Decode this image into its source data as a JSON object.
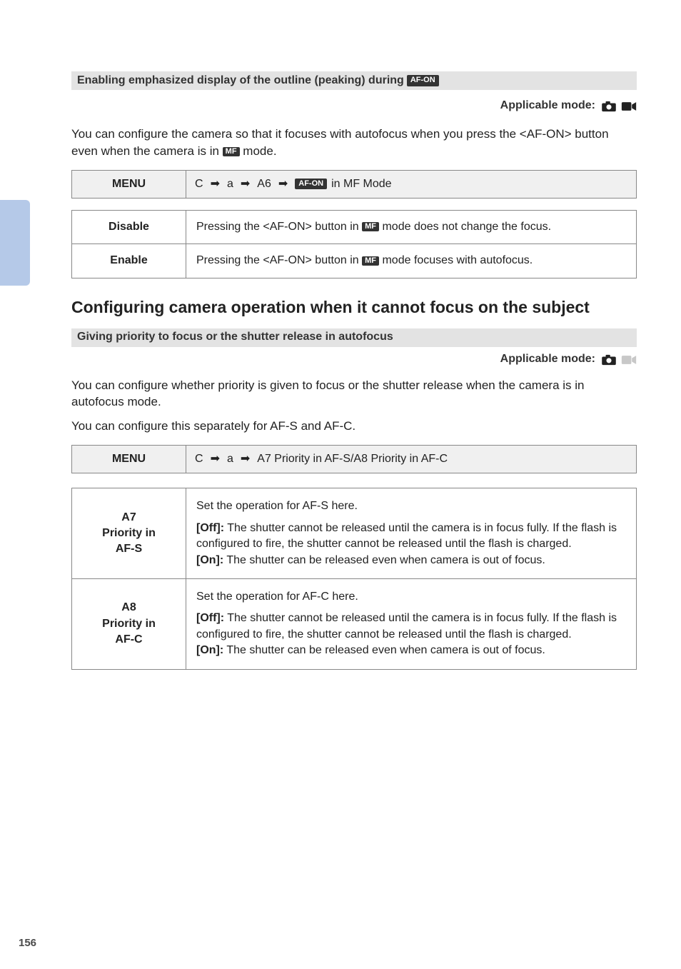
{
  "page_number": "156",
  "section1": {
    "bar_text_before": "Enabling emphasized display of the outline (peaking) during ",
    "bar_badge": "AF-ON",
    "mode_label": "Applicable mode:",
    "mode_photo_aria": "Photo mode (supported)",
    "mode_movie_aria": "Movie mode (supported)",
    "paragraph": "You can configure the camera so that it focuses with autofocus when you press the <AF-ON> button even when the camera is in ",
    "paragraph_badge": "MF",
    "paragraph_tail": " mode.",
    "menu_label": "MENU",
    "menu_path_parts": [
      "C",
      "a",
      "A6"
    ],
    "menu_path_badge": "AF-ON",
    "menu_path_tail": " in MF Mode",
    "rows": [
      {
        "label": "Disable",
        "text_before": "Pressing the <AF-ON> button in ",
        "badge": "MF",
        "text_after": " mode does not change the focus."
      },
      {
        "label": "Enable",
        "text_before": "Pressing the <AF-ON> button in ",
        "badge": "MF",
        "text_after": " mode focuses with autofocus."
      }
    ]
  },
  "section2": {
    "heading": "Configuring camera operation when it cannot focus on the subject",
    "bar_text": "Giving priority to focus or the shutter release in autofocus",
    "mode_label": "Applicable mode:",
    "mode_photo_aria": "Photo mode (supported)",
    "mode_movie_aria": "Movie mode (not supported)",
    "paragraph1": "You can configure whether priority is given to focus or the shutter release when the camera is in autofocus mode.",
    "paragraph2": "You can configure this separately for AF-S and AF-C.",
    "menu_label": "MENU",
    "menu_path_parts": [
      "C",
      "a",
      "A7 Priority in AF-S/A8 Priority in AF-C"
    ],
    "rows": [
      {
        "label": "A7\nPriority in\nAF-S",
        "intro": "Set the operation for AF-S here.",
        "off_label": "[Off]:",
        "off_text": " The shutter cannot be released until the camera is in focus fully. If the flash is configured to fire, the shutter cannot be released until the flash is charged.",
        "on_label": "[On]:",
        "on_text": " The shutter can be released even when camera is out of focus."
      },
      {
        "label": "A8\nPriority in\nAF-C",
        "intro": "Set the operation for AF-C here.",
        "off_label": "[Off]:",
        "off_text": " The shutter cannot be released until the camera is in focus fully. If the flash is configured to fire, the shutter cannot be released until the flash is charged.",
        "on_label": "[On]:",
        "on_text": " The shutter can be released even when camera is out of focus."
      }
    ]
  }
}
